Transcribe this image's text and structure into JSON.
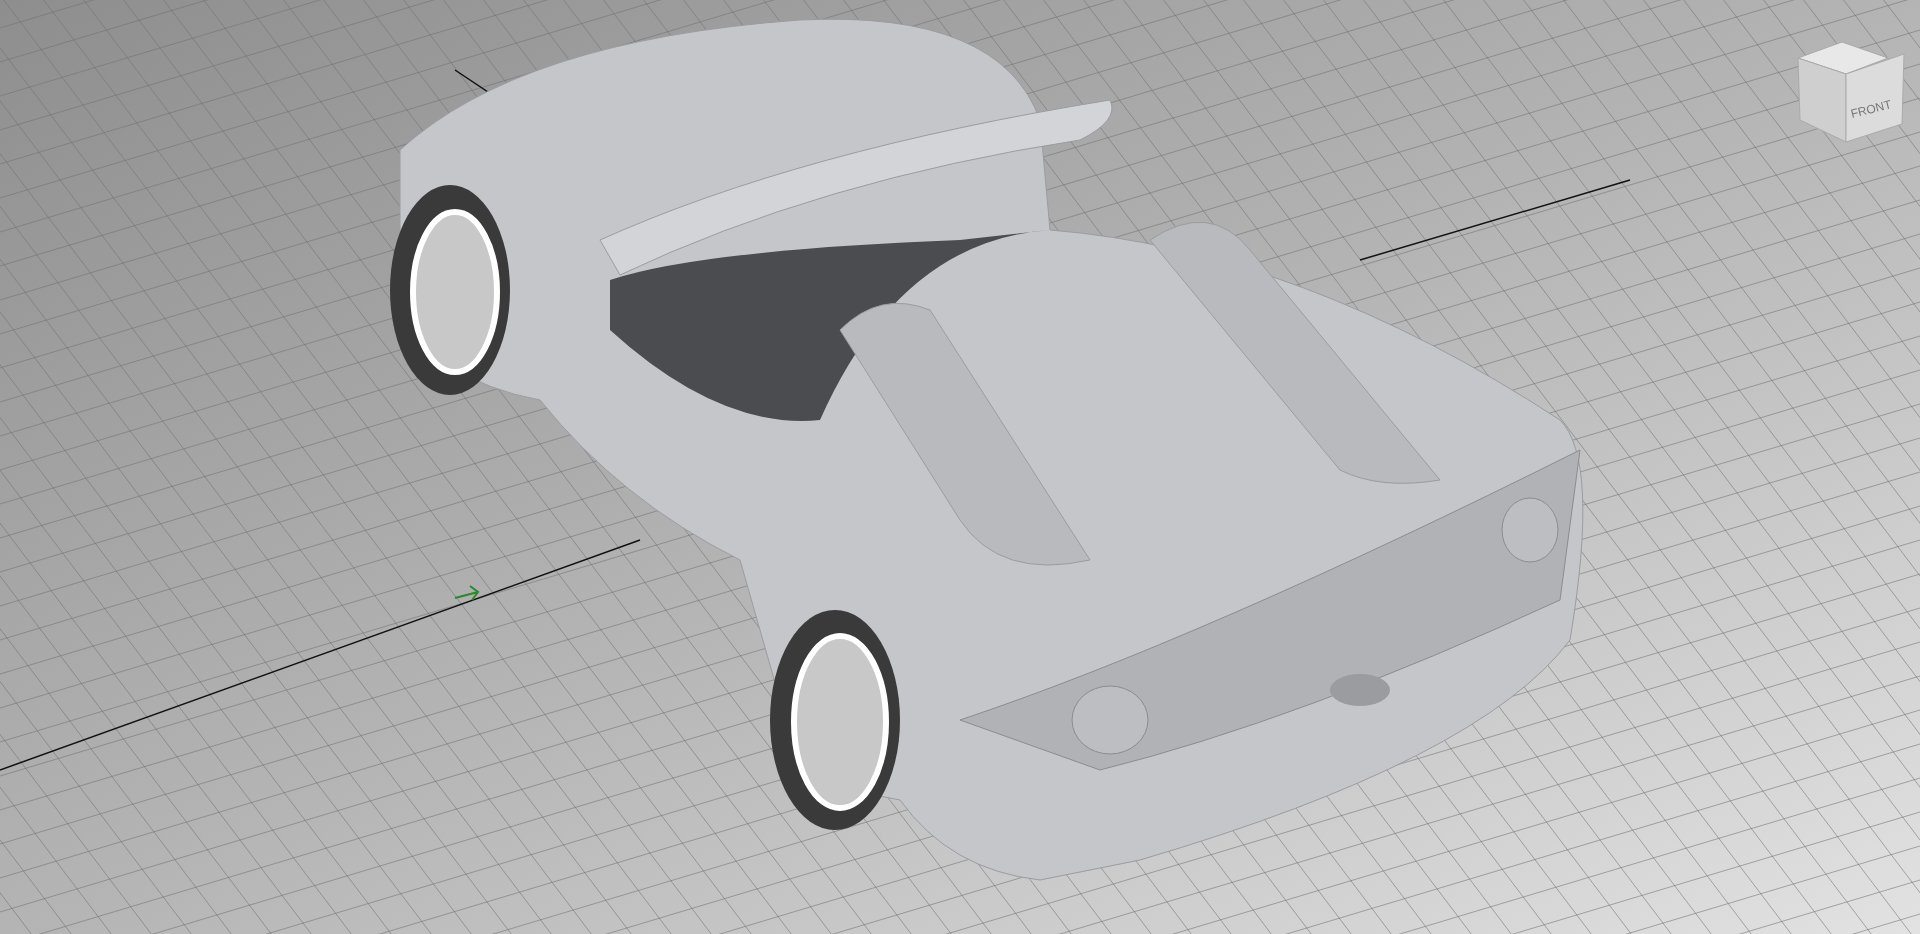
{
  "viewport": {
    "view_cube": {
      "front_label": "FRONT"
    }
  }
}
